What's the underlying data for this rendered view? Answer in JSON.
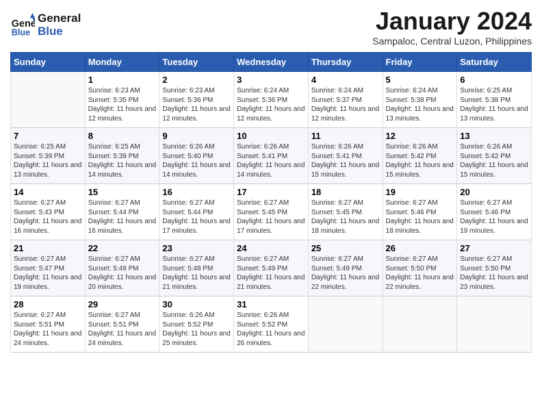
{
  "header": {
    "logo_line1": "General",
    "logo_line2": "Blue",
    "month_title": "January 2024",
    "subtitle": "Sampaloc, Central Luzon, Philippines"
  },
  "days_of_week": [
    "Sunday",
    "Monday",
    "Tuesday",
    "Wednesday",
    "Thursday",
    "Friday",
    "Saturday"
  ],
  "weeks": [
    [
      {
        "num": "",
        "empty": true
      },
      {
        "num": "1",
        "sunrise": "6:23 AM",
        "sunset": "5:35 PM",
        "daylight": "11 hours and 12 minutes."
      },
      {
        "num": "2",
        "sunrise": "6:23 AM",
        "sunset": "5:36 PM",
        "daylight": "11 hours and 12 minutes."
      },
      {
        "num": "3",
        "sunrise": "6:24 AM",
        "sunset": "5:36 PM",
        "daylight": "11 hours and 12 minutes."
      },
      {
        "num": "4",
        "sunrise": "6:24 AM",
        "sunset": "5:37 PM",
        "daylight": "11 hours and 12 minutes."
      },
      {
        "num": "5",
        "sunrise": "6:24 AM",
        "sunset": "5:38 PM",
        "daylight": "11 hours and 13 minutes."
      },
      {
        "num": "6",
        "sunrise": "6:25 AM",
        "sunset": "5:38 PM",
        "daylight": "11 hours and 13 minutes."
      }
    ],
    [
      {
        "num": "7",
        "sunrise": "6:25 AM",
        "sunset": "5:39 PM",
        "daylight": "11 hours and 13 minutes."
      },
      {
        "num": "8",
        "sunrise": "6:25 AM",
        "sunset": "5:39 PM",
        "daylight": "11 hours and 14 minutes."
      },
      {
        "num": "9",
        "sunrise": "6:26 AM",
        "sunset": "5:40 PM",
        "daylight": "11 hours and 14 minutes."
      },
      {
        "num": "10",
        "sunrise": "6:26 AM",
        "sunset": "5:41 PM",
        "daylight": "11 hours and 14 minutes."
      },
      {
        "num": "11",
        "sunrise": "6:26 AM",
        "sunset": "5:41 PM",
        "daylight": "11 hours and 15 minutes."
      },
      {
        "num": "12",
        "sunrise": "6:26 AM",
        "sunset": "5:42 PM",
        "daylight": "11 hours and 15 minutes."
      },
      {
        "num": "13",
        "sunrise": "6:26 AM",
        "sunset": "5:42 PM",
        "daylight": "11 hours and 15 minutes."
      }
    ],
    [
      {
        "num": "14",
        "sunrise": "6:27 AM",
        "sunset": "5:43 PM",
        "daylight": "11 hours and 16 minutes."
      },
      {
        "num": "15",
        "sunrise": "6:27 AM",
        "sunset": "5:44 PM",
        "daylight": "11 hours and 16 minutes."
      },
      {
        "num": "16",
        "sunrise": "6:27 AM",
        "sunset": "5:44 PM",
        "daylight": "11 hours and 17 minutes."
      },
      {
        "num": "17",
        "sunrise": "6:27 AM",
        "sunset": "5:45 PM",
        "daylight": "11 hours and 17 minutes."
      },
      {
        "num": "18",
        "sunrise": "6:27 AM",
        "sunset": "5:45 PM",
        "daylight": "11 hours and 18 minutes."
      },
      {
        "num": "19",
        "sunrise": "6:27 AM",
        "sunset": "5:46 PM",
        "daylight": "11 hours and 18 minutes."
      },
      {
        "num": "20",
        "sunrise": "6:27 AM",
        "sunset": "5:46 PM",
        "daylight": "11 hours and 19 minutes."
      }
    ],
    [
      {
        "num": "21",
        "sunrise": "6:27 AM",
        "sunset": "5:47 PM",
        "daylight": "11 hours and 19 minutes."
      },
      {
        "num": "22",
        "sunrise": "6:27 AM",
        "sunset": "5:48 PM",
        "daylight": "11 hours and 20 minutes."
      },
      {
        "num": "23",
        "sunrise": "6:27 AM",
        "sunset": "5:48 PM",
        "daylight": "11 hours and 21 minutes."
      },
      {
        "num": "24",
        "sunrise": "6:27 AM",
        "sunset": "5:49 PM",
        "daylight": "11 hours and 21 minutes."
      },
      {
        "num": "25",
        "sunrise": "6:27 AM",
        "sunset": "5:49 PM",
        "daylight": "11 hours and 22 minutes."
      },
      {
        "num": "26",
        "sunrise": "6:27 AM",
        "sunset": "5:50 PM",
        "daylight": "11 hours and 22 minutes."
      },
      {
        "num": "27",
        "sunrise": "6:27 AM",
        "sunset": "5:50 PM",
        "daylight": "11 hours and 23 minutes."
      }
    ],
    [
      {
        "num": "28",
        "sunrise": "6:27 AM",
        "sunset": "5:51 PM",
        "daylight": "11 hours and 24 minutes."
      },
      {
        "num": "29",
        "sunrise": "6:27 AM",
        "sunset": "5:51 PM",
        "daylight": "11 hours and 24 minutes."
      },
      {
        "num": "30",
        "sunrise": "6:26 AM",
        "sunset": "5:52 PM",
        "daylight": "11 hours and 25 minutes."
      },
      {
        "num": "31",
        "sunrise": "6:26 AM",
        "sunset": "5:52 PM",
        "daylight": "11 hours and 26 minutes."
      },
      {
        "num": "",
        "empty": true
      },
      {
        "num": "",
        "empty": true
      },
      {
        "num": "",
        "empty": true
      }
    ]
  ],
  "labels": {
    "sunrise": "Sunrise:",
    "sunset": "Sunset:",
    "daylight": "Daylight:"
  }
}
